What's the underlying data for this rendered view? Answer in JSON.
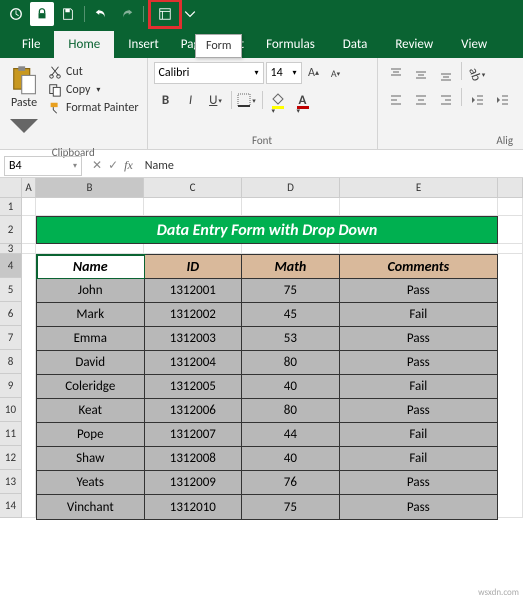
{
  "qat": {
    "tooltip": "Form"
  },
  "tabs": [
    "File",
    "Home",
    "Insert",
    "Page Layout",
    "Formulas",
    "Data",
    "Review",
    "View"
  ],
  "active_tab": "Home",
  "clipboard": {
    "paste": "Paste",
    "cut": "Cut",
    "copy": "Copy",
    "painter": "Format Painter",
    "group": "Clipboard"
  },
  "font": {
    "name": "Calibri",
    "size": "14",
    "group": "Font"
  },
  "align": {
    "group": "Alig"
  },
  "namebox": "B4",
  "formula": "Name",
  "cols": [
    "A",
    "B",
    "C",
    "D",
    "E"
  ],
  "banner": "Data Entry Form with Drop Down",
  "headers": {
    "name": "Name",
    "id": "ID",
    "math": "Math",
    "comments": "Comments"
  },
  "chart_data": {
    "type": "table",
    "columns": [
      "Name",
      "ID",
      "Math",
      "Comments"
    ],
    "rows": [
      [
        "John",
        "1312001",
        "75",
        "Pass"
      ],
      [
        "Mark",
        "1312002",
        "45",
        "Fail"
      ],
      [
        "Emma",
        "1312003",
        "53",
        "Pass"
      ],
      [
        "David",
        "1312004",
        "80",
        "Pass"
      ],
      [
        "Coleridge",
        "1312005",
        "40",
        "Fail"
      ],
      [
        "Keat",
        "1312006",
        "80",
        "Pass"
      ],
      [
        "Pope",
        "1312007",
        "44",
        "Fail"
      ],
      [
        "Shaw",
        "1312008",
        "40",
        "Fail"
      ],
      [
        "Yeats",
        "1312009",
        "76",
        "Pass"
      ],
      [
        "Vinchant",
        "1312010",
        "75",
        "Pass"
      ]
    ]
  },
  "watermark": "wsxdn.com"
}
